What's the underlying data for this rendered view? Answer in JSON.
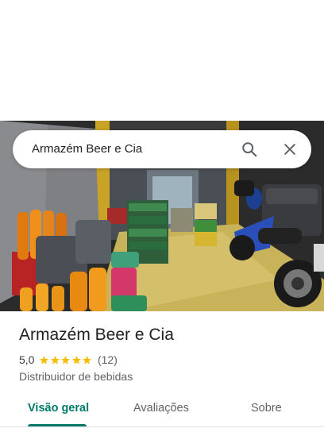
{
  "search": {
    "query": "Armazém Beer e Cia"
  },
  "place": {
    "name": "Armazém Beer e Cia",
    "rating": "5,0",
    "stars": 5,
    "review_count": "(12)",
    "category": "Distribuidor de bebidas"
  },
  "tabs": [
    {
      "label": "Visão geral",
      "active": true
    },
    {
      "label": "Avaliações",
      "active": false
    },
    {
      "label": "Sobre",
      "active": false
    }
  ],
  "colors": {
    "accent": "#00796b",
    "star": "#fbbc04",
    "text_primary": "#202124",
    "text_secondary": "#5f6368"
  },
  "icons": {
    "search": "search-icon",
    "close": "close-icon",
    "star": "star-icon"
  }
}
